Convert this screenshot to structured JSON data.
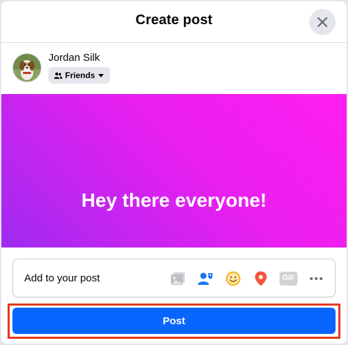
{
  "dialog": {
    "title": "Create post",
    "close_icon": "close-icon"
  },
  "user": {
    "name": "Jordan Silk",
    "avatar_icon": "dog-photo-avatar",
    "audience_icon": "friends-icon",
    "audience_label": "Friends",
    "audience_caret": "caret-down-icon"
  },
  "post": {
    "text": "Hey there everyone!",
    "background_colors": [
      "#ff1ef0",
      "#9f2bf0"
    ]
  },
  "add_to_post": {
    "label": "Add to your post",
    "icons": [
      "photo-video-icon",
      "tag-people-icon",
      "feeling-activity-icon",
      "check-in-icon",
      "gif-icon",
      "more-icon"
    ],
    "gif_label": "GIF"
  },
  "actions": {
    "post_label": "Post",
    "post_color": "#0866ff",
    "highlight_color": "#e2391a"
  }
}
